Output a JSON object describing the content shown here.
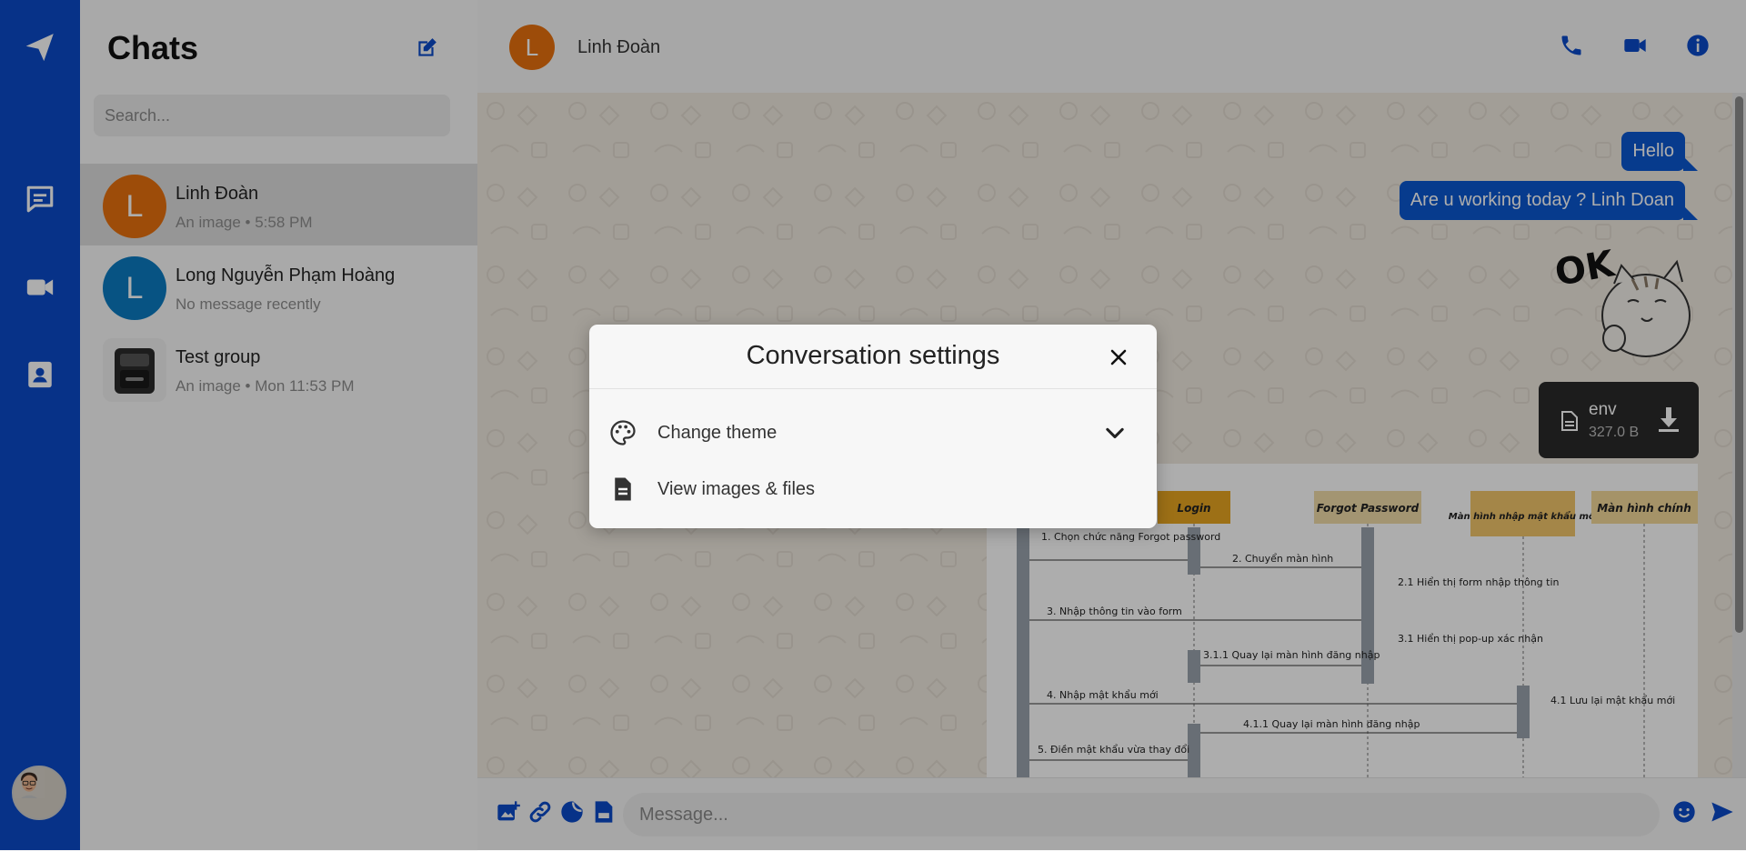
{
  "sidebar": {
    "title": "Chats",
    "search_placeholder": "Search...",
    "chats": [
      {
        "initial": "L",
        "name": "Linh Đoàn",
        "preview": "An image • 5:58 PM",
        "color": "#e8710e",
        "active": true
      },
      {
        "initial": "L",
        "name": "Long Nguyễn Phạm Hoàng",
        "preview": "No message recently",
        "color": "#0b7bc2",
        "active": false
      },
      {
        "initial": "",
        "name": "Test group",
        "preview": "An image • Mon 11:53 PM",
        "color": "#3a3a3a",
        "active": false
      }
    ]
  },
  "conversation": {
    "contact_initial": "L",
    "contact_name": "Linh Đoàn",
    "messages": [
      {
        "text": "Hello"
      },
      {
        "text": "Are u working today ? Linh Doan"
      }
    ],
    "sticker_text": "OK",
    "file": {
      "name": "env",
      "size": "327.0 B"
    },
    "diagram": {
      "lanes": [
        "Login",
        "Forgot Password",
        "Màn hình nhập mật khẩu mới",
        "Màn hình chính"
      ],
      "steps": [
        "1. Chọn chức năng Forgot password",
        "2. Chuyển màn hình",
        "2.1 Hiển thị form nhập thông tin",
        "3. Nhập thông tin vào form",
        "3.1 Hiển thị pop-up xác nhận",
        "3.1.1 Quay lại màn hình đăng nhập",
        "4. Nhập mật khẩu mới",
        "4.1 Lưu lại mật khẩu mới",
        "4.1.1 Quay lại màn hình đăng nhập",
        "5. Điền mật khẩu vừa thay đổi"
      ]
    },
    "composer_placeholder": "Message..."
  },
  "modal": {
    "title": "Conversation settings",
    "options": [
      {
        "label": "Change theme"
      },
      {
        "label": "View images & files"
      }
    ]
  },
  "colors": {
    "brand": "#0b4ac9",
    "bubble": "#0b57d0",
    "chat_bg": "#efe9df"
  }
}
